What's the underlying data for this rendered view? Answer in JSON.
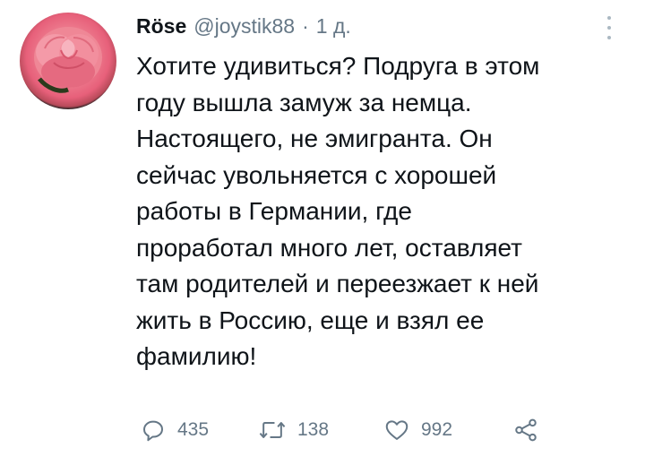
{
  "tweet": {
    "author_name": "Röse",
    "handle": "@joystik88",
    "separator": "·",
    "time": "1 д.",
    "text_lines": [
      "Хотите удивиться? Подруга в этом",
      "году вышла замуж за немца.",
      "Настоящего, не эмигранта. Он",
      "сейчас увольняется с хорошей",
      "работы в Германии, где",
      "проработал много лет, оставляет",
      "там родителей и переезжает к ней",
      "жить в Россию, еще и взял ее",
      "фамилию!"
    ],
    "avatar_icon": "rose-image",
    "more_icon": "more-vertical-icon"
  },
  "actions": {
    "replies": {
      "icon": "reply-icon",
      "count": "435"
    },
    "retweets": {
      "icon": "retweet-icon",
      "count": "138"
    },
    "likes": {
      "icon": "heart-icon",
      "count": "992"
    },
    "share": {
      "icon": "share-icon"
    }
  },
  "colors": {
    "text": "#0f1419",
    "secondary": "#657786",
    "rose": "#ee7e90"
  }
}
